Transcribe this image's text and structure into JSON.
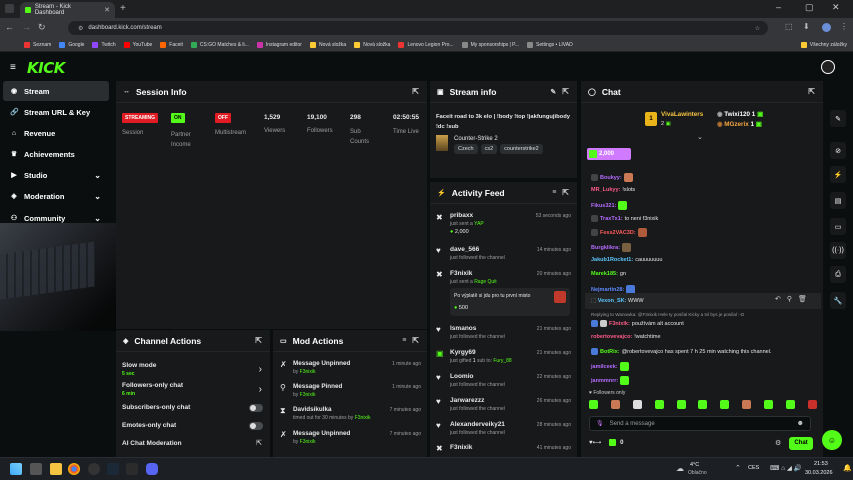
{
  "browser": {
    "tab_title": "Stream - Kick Dashboard",
    "url": "dashboard.kick.com/stream",
    "bookmarks": [
      "Seznam",
      "Google",
      "Twitch",
      "YouTube",
      "Faceit",
      "CS:GO Matches & li...",
      "Instagram editor",
      "Nová složka",
      "Nová složka",
      "Lenovo Legion Pro...",
      "My sponsorships | P...",
      "Settings • LIVAD"
    ],
    "bookmarks_all": "Všechny záložky"
  },
  "brand": {
    "logo": "KICK",
    "accent": "#53fc18"
  },
  "sidebar": {
    "items": [
      {
        "label": "Stream",
        "icon": "stream-icon",
        "active": true
      },
      {
        "label": "Stream URL & Key",
        "icon": "link-icon"
      },
      {
        "label": "Revenue",
        "icon": "bank-icon"
      },
      {
        "label": "Achievements",
        "icon": "trophy-icon"
      },
      {
        "label": "Studio",
        "icon": "video-icon",
        "chevron": true
      },
      {
        "label": "Moderation",
        "icon": "shield-icon",
        "chevron": true
      },
      {
        "label": "Community",
        "icon": "people-icon",
        "chevron": true
      }
    ]
  },
  "session": {
    "title": "Session Info",
    "stats": [
      {
        "value": "STREAMING",
        "label": "Session",
        "badge": "#e01b24"
      },
      {
        "value": "ON",
        "label": "Partner Income",
        "badge": "#53fc18"
      },
      {
        "value": "OFF",
        "label": "Multistream",
        "badge": "#e01b24"
      },
      {
        "value": "1,529",
        "label": "Viewers"
      },
      {
        "value": "19,100",
        "label": "Followers"
      },
      {
        "value": "298",
        "label": "Sub Counts"
      },
      {
        "value": "02:50:55",
        "label": "Time Live"
      }
    ]
  },
  "stream_info": {
    "title": "Stream info",
    "stream_title": "Faceit road to 3k elo | !body !top !jakfungujibody !dc !sub",
    "category": "Counter-Strike 2",
    "tags": [
      "Czech",
      "cs2",
      "counterstrike2"
    ]
  },
  "activity": {
    "title": "Activity Feed",
    "items": [
      {
        "user": "pribaxx",
        "action": "just sent a",
        "target": "YAP",
        "amount": "2,000",
        "time": "53 seconds ago",
        "icon": "kicks-icon"
      },
      {
        "user": "dave_566",
        "action": "just followed the channel",
        "time": "14 minutes ago",
        "icon": "heart-icon"
      },
      {
        "user": "F3nixik",
        "action": "just sent a",
        "target": "Rage Quit",
        "message": "Po výplatě si jdu pro tu první misto",
        "amount": "500",
        "time": "20 minutes ago",
        "icon": "kicks-icon"
      },
      {
        "user": "lsmanos",
        "action": "just followed the channel",
        "time": "21 minutes ago",
        "icon": "heart-icon"
      },
      {
        "user": "Kyrgy69",
        "action": "just gifted",
        "count": "1",
        "mid": "sub to:",
        "target": "Fury_88",
        "time": "21 minutes ago",
        "icon": "gift-icon"
      },
      {
        "user": "Loomio",
        "action": "just followed the channel",
        "time": "22 minutes ago",
        "icon": "heart-icon"
      },
      {
        "user": "Jarwarezzz",
        "action": "just followed the channel",
        "time": "26 minutes ago",
        "icon": "heart-icon"
      },
      {
        "user": "Alexanderveiky21",
        "action": "just followed the channel",
        "time": "28 minutes ago",
        "icon": "heart-icon"
      },
      {
        "user": "F3nixik",
        "action": "",
        "time": "41 minutes ago",
        "icon": "kicks-icon"
      }
    ]
  },
  "channel_actions": {
    "title": "Channel Actions",
    "items": [
      {
        "label": "Slow mode",
        "sub": "5 sec",
        "control": "chevron"
      },
      {
        "label": "Followers-only chat",
        "sub": "6 min",
        "control": "chevron"
      },
      {
        "label": "Subscribers-only chat",
        "control": "toggle"
      },
      {
        "label": "Emotes-only chat",
        "control": "toggle"
      },
      {
        "label": "AI Chat Moderation",
        "control": "popout"
      }
    ]
  },
  "mod_actions": {
    "title": "Mod Actions",
    "items": [
      {
        "action": "Message Unpinned",
        "by": "F3nixik",
        "time": "1 minute ago",
        "icon": "unpin-icon"
      },
      {
        "action": "Message Pinned",
        "by": "F3nixik",
        "time": "1 minute ago",
        "icon": "pin-icon"
      },
      {
        "action": "Davidsikulka",
        "detail": "timed out for 30 minutes by",
        "by": "F3nixik",
        "time": "7 minutes ago",
        "icon": "timeout-icon"
      },
      {
        "action": "Message Unpinned",
        "by": "F3nixik",
        "time": "7 minutes ago",
        "icon": "unpin-icon"
      }
    ],
    "by_label": "by"
  },
  "chat": {
    "title": "Chat",
    "leaders": [
      {
        "name": "VivaLawinters",
        "count": "2",
        "rank": "1"
      },
      {
        "name": "Twixi120",
        "count": "1"
      },
      {
        "name": "MGzerix",
        "count": "1"
      }
    ],
    "pinned_amount": "2,000",
    "lines": [
      {
        "user": "Boukyy:",
        "color": "#b66cff",
        "text": ""
      },
      {
        "user": "MR_Lukyy:",
        "color": "#ff5c8a",
        "text": "!slots"
      },
      {
        "user": "Fikus321:",
        "color": "#b66cff",
        "text": ""
      },
      {
        "user": "TraxTx1:",
        "color": "#b66cff",
        "text": "to neni f3nixik"
      },
      {
        "user": "Fess2VAC3D:",
        "color": "#ff5c5c",
        "text": ""
      },
      {
        "user": "Burgklikra:",
        "color": "#b66cff",
        "text": ""
      },
      {
        "user": "Jakub1Rocket1:",
        "color": "#5cc8ff",
        "text": "cauuuuuuu"
      },
      {
        "user": "Marek185:",
        "color": "#53fc18",
        "text": "gn"
      },
      {
        "user": "Nejmartin28:",
        "color": "#5c8aff",
        "text": ""
      },
      {
        "user": "Vexon_SK:",
        "color": "#5cc8ff",
        "text": "WWW"
      },
      {
        "user": "F3nixik:",
        "color": "#ff5c8a",
        "text": "používám alt account"
      },
      {
        "user": "robertovevajco:",
        "color": "#ff5c8a",
        "text": "!watchtime"
      },
      {
        "user": "BotRix:",
        "color": "#53fc18",
        "text": "@robertovevajco has spent 7 h 25 min watching this channel."
      },
      {
        "user": "jamilceek:",
        "color": "#b66cff",
        "text": ""
      },
      {
        "user": "janmmnrr:",
        "color": "#b66cff",
        "text": ""
      }
    ],
    "reply_to": "Replying to Wanowka: @F3nixik Hele ty posílal Kicky a tvl bys je posílal :-D",
    "followers_only": "Followers only",
    "input_placeholder": "Send a message",
    "kicks_count": "0",
    "chat_button": "Chat"
  },
  "taskbar": {
    "weather_temp": "4°C",
    "weather_text": "Oblačno",
    "lang": "CES",
    "time": "21:53",
    "date": "30.03.2026"
  }
}
